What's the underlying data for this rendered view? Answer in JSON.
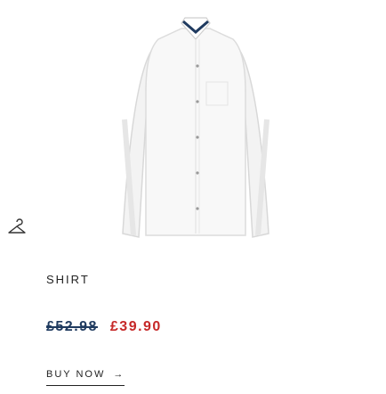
{
  "product": {
    "name": "SHIRT",
    "old_price": "£52.98",
    "sale_price": "£39.90",
    "image_icon": "shirt-product-image",
    "category_icon": "hanger-icon"
  },
  "cta": {
    "label": "BUY NOW",
    "arrow": "→",
    "icon": "arrow-right-icon"
  },
  "colors": {
    "old_price": "#1f3a5f",
    "sale_price": "#c62828",
    "text": "#222222"
  }
}
